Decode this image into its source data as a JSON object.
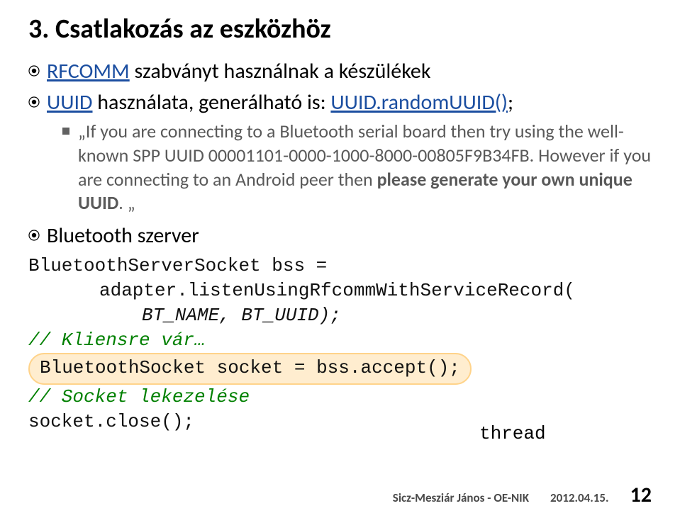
{
  "title": "3. Csatlakozás az eszközhöz",
  "bullets": {
    "b1_prefix": "RFCOMM",
    "b1_rest": " szabványt használnak a készülékek",
    "b2_prefix": "UUID",
    "b2_mid": " használata,  generálható is: ",
    "b2_link": "UUID.randomUUID()",
    "b2_suffix": ";",
    "b3": "Bluetooth szerver"
  },
  "sub": {
    "q1": "„",
    "t1": "If you are connecting to a Bluetooth serial board then try using the well-known SPP UUID 00001101-0000-1000-8000-00805F9B34FB. However if you are connecting to an Android peer then ",
    "bold": "please generate your own unique UUID",
    "t2": ". ",
    "q2": "„"
  },
  "code": {
    "l1": "BluetoothServerSocket bss =",
    "l2": "adapter.listenUsingRfcommWithServiceRecord(",
    "l3": "BT_NAME, BT_UUID);",
    "l4": "// Kliensre vár…",
    "l5": "BluetoothSocket socket = bss.accept();",
    "l6": "// Socket lekezelése",
    "l7": "socket.close();",
    "thread": "thread"
  },
  "footer": {
    "author": "Sicz-Mesziár János - OE-NIK",
    "date": "2012.04.15.",
    "page": "12"
  }
}
